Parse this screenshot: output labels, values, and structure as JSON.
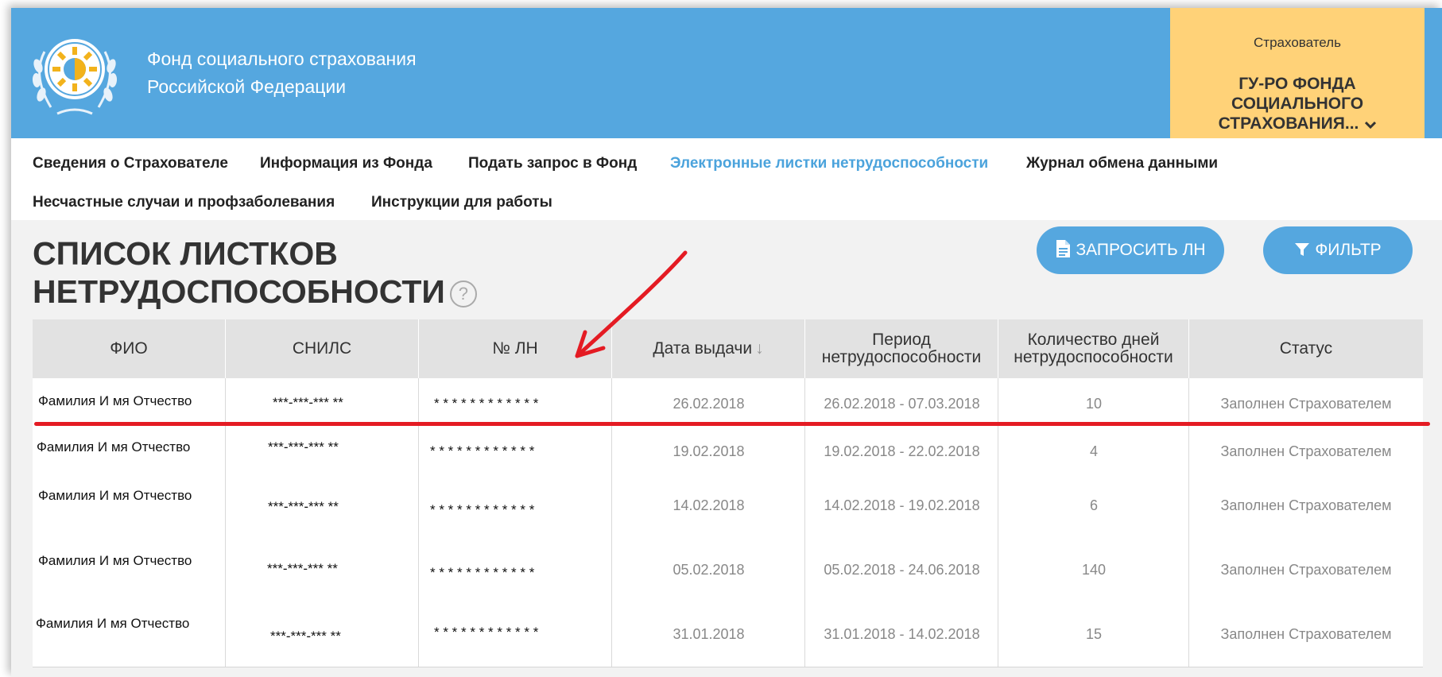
{
  "header": {
    "org_line1": "Фонд социального страхования",
    "org_line2": "Российской Федерации",
    "insurer_label": "Страхователь",
    "insurer_name_1": "ГУ-РО ФОНДА",
    "insurer_name_2": "СОЦИАЛЬНОГО",
    "insurer_name_3": "СТРАХОВАНИЯ..."
  },
  "nav": {
    "items": [
      "Сведения о Страхователе",
      "Информация из Фонда",
      "Подать запрос в Фонд",
      "Электронные листки нетрудоспособности",
      "Журнал обмена данными",
      "Несчастные случаи и профзаболевания",
      "Инструкции для работы"
    ],
    "active": "Электронные листки нетрудоспособности"
  },
  "page": {
    "title_line1": "СПИСОК ЛИСТКОВ",
    "title_line2": "НЕТРУДОСПОСОБНОСТИ",
    "help": "?",
    "request_button": "ЗАПРОСИТЬ ЛН",
    "filter_button": "ФИЛЬТР"
  },
  "table": {
    "headers": {
      "fio": "ФИО",
      "snils": "СНИЛС",
      "ln": "№ ЛН",
      "date": "Дата выдачи",
      "sort_arrow": "↓",
      "period_1": "Период",
      "period_2": "нетрудоспособности",
      "days_1": "Количество дней",
      "days_2": "нетрудоспособности",
      "status": "Статус"
    },
    "rows": [
      {
        "fio": "Фамилия И мя Отчество",
        "snils": "***-***-*** **",
        "ln": "* * * * * * * * * * * *",
        "date": "26.02.2018",
        "period": "26.02.2018 - 07.03.2018",
        "days": "10",
        "status": "Заполнен Страхователем"
      },
      {
        "fio": "Фамилия И мя Отчество",
        "snils": "***-***-*** **",
        "ln": "* * * * * * * * * * * *",
        "date": "19.02.2018",
        "period": "19.02.2018 - 22.02.2018",
        "days": "4",
        "status": "Заполнен Страхователем"
      },
      {
        "fio": "Фамилия И мя Отчество",
        "snils": "***-***-*** **",
        "ln": "* * * * * * * * * * * *",
        "date": "14.02.2018",
        "period": "14.02.2018 - 19.02.2018",
        "days": "6",
        "status": "Заполнен Страхователем"
      },
      {
        "fio": "Фамилия И мя Отчество",
        "snils": "***-***-*** **",
        "ln": "* * * * * * * * * * * *",
        "date": "05.02.2018",
        "period": "05.02.2018 - 24.06.2018",
        "days": "140",
        "status": "Заполнен Страхователем"
      },
      {
        "fio": "Фамилия И мя Отчество",
        "snils": "***-***-*** **",
        "ln": "* * * * * * * * * * * *",
        "date": "31.01.2018",
        "period": "31.01.2018 - 14.02.2018",
        "days": "15",
        "status": "Заполнен Страхователем"
      }
    ]
  },
  "colors": {
    "header_bg": "#55a7df",
    "insurer_bg": "#ffd278",
    "active_nav": "#4ba3dc",
    "annotation_red": "#e41b23"
  },
  "icons": [
    "fss-emblem-icon",
    "chevron-down-icon",
    "help-icon",
    "document-icon",
    "filter-icon",
    "annotation-arrow-icon"
  ]
}
